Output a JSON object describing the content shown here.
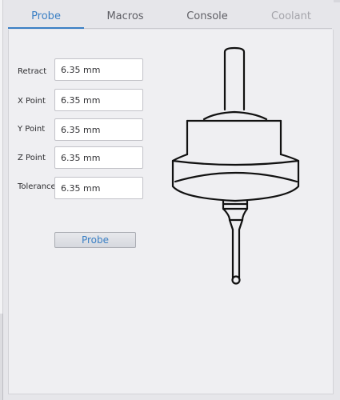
{
  "tabs": [
    {
      "label": "Probe",
      "state": "active"
    },
    {
      "label": "Macros",
      "state": "normal"
    },
    {
      "label": "Console",
      "state": "normal"
    },
    {
      "label": "Coolant",
      "state": "disabled"
    }
  ],
  "fields": {
    "retract": {
      "label": "Retract",
      "value": "6.35 mm"
    },
    "x_point": {
      "label": "X Point",
      "value": "6.35 mm"
    },
    "y_point": {
      "label": "Y Point",
      "value": "6.35 mm"
    },
    "z_point": {
      "label": "Z Point",
      "value": "6.35 mm"
    },
    "tolerance": {
      "label": "Tolerance",
      "value": "6.35 mm"
    }
  },
  "probe_button_label": "Probe",
  "colors": {
    "accent": "#3a7fc4",
    "panel": "#efeff2",
    "disabled_text": "#a4a4aa"
  },
  "illustration": {
    "icon": "touch-probe-icon"
  }
}
